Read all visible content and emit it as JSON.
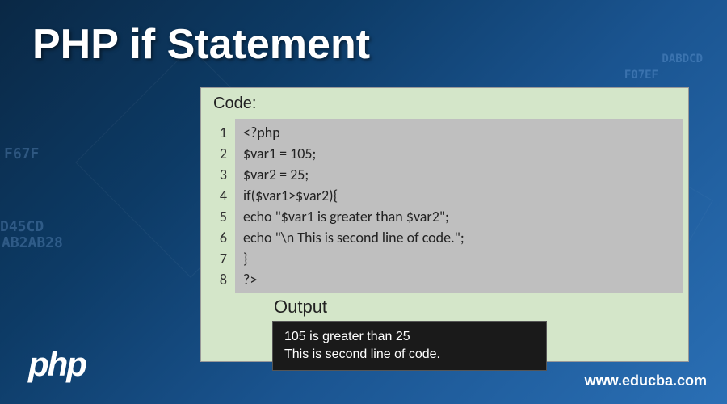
{
  "title": "PHP if Statement",
  "codeLabel": "Code:",
  "code": {
    "lines": [
      "1",
      "2",
      "3",
      "4",
      "5",
      "6",
      "7",
      "8"
    ],
    "content": "<?php\n$var1 = 105;\n$var2 = 25;\nif($var1>$var2){\necho \"$var1 is greater than $var2\";\necho \"\\n This is second line of code.\";\n}\n?>"
  },
  "outputLabel": "Output",
  "output": {
    "line1": "105 is greater than 25",
    "line2": "This is second line of code."
  },
  "logo": "php",
  "website": "www.educba.com",
  "bgHex": {
    "h1": "F67F",
    "h2": "D45CD",
    "h3": "AB2AB28",
    "h4": "DABDCD",
    "h5": "F07EF"
  }
}
